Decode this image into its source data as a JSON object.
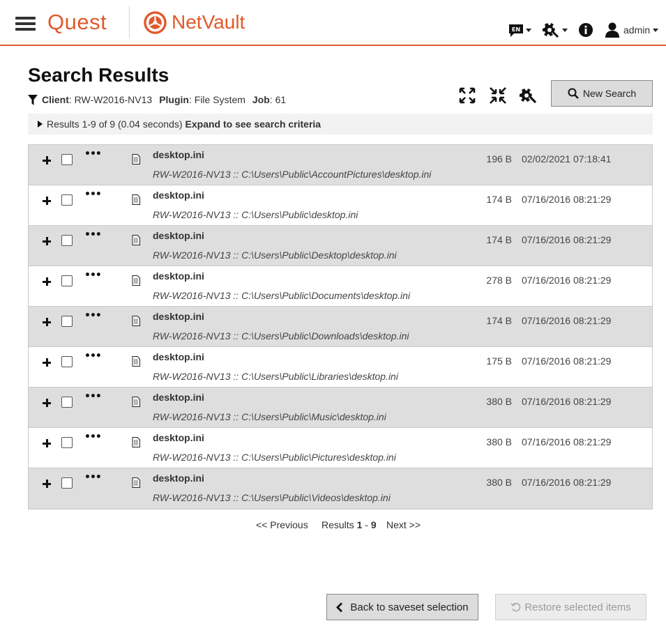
{
  "header": {
    "brand": "Quest",
    "product": "NetVault",
    "language_badge": "EN",
    "user": "admin",
    "accent_color": "#e05a2b"
  },
  "page": {
    "title": "Search Results",
    "filter": {
      "client_label": "Client",
      "client_value": "RW-W2016-NV13",
      "plugin_label": "Plugin",
      "plugin_value": "File System",
      "job_label": "Job",
      "job_value": "61"
    },
    "new_search_label": "New Search",
    "summary_text": "Results 1-9 of 9 (0.04 seconds)",
    "summary_link": "Expand to see search criteria"
  },
  "results": [
    {
      "name": "desktop.ini",
      "path": "RW-W2016-NV13 :: C:\\Users\\Public\\AccountPictures\\desktop.ini",
      "size": "196 B",
      "date": "02/02/2021 07:18:41"
    },
    {
      "name": "desktop.ini",
      "path": "RW-W2016-NV13 :: C:\\Users\\Public\\desktop.ini",
      "size": "174 B",
      "date": "07/16/2016 08:21:29"
    },
    {
      "name": "desktop.ini",
      "path": "RW-W2016-NV13 :: C:\\Users\\Public\\Desktop\\desktop.ini",
      "size": "174 B",
      "date": "07/16/2016 08:21:29"
    },
    {
      "name": "desktop.ini",
      "path": "RW-W2016-NV13 :: C:\\Users\\Public\\Documents\\desktop.ini",
      "size": "278 B",
      "date": "07/16/2016 08:21:29"
    },
    {
      "name": "desktop.ini",
      "path": "RW-W2016-NV13 :: C:\\Users\\Public\\Downloads\\desktop.ini",
      "size": "174 B",
      "date": "07/16/2016 08:21:29"
    },
    {
      "name": "desktop.ini",
      "path": "RW-W2016-NV13 :: C:\\Users\\Public\\Libraries\\desktop.ini",
      "size": "175 B",
      "date": "07/16/2016 08:21:29"
    },
    {
      "name": "desktop.ini",
      "path": "RW-W2016-NV13 :: C:\\Users\\Public\\Music\\desktop.ini",
      "size": "380 B",
      "date": "07/16/2016 08:21:29"
    },
    {
      "name": "desktop.ini",
      "path": "RW-W2016-NV13 :: C:\\Users\\Public\\Pictures\\desktop.ini",
      "size": "380 B",
      "date": "07/16/2016 08:21:29"
    },
    {
      "name": "desktop.ini",
      "path": "RW-W2016-NV13 :: C:\\Users\\Public\\Videos\\desktop.ini",
      "size": "380 B",
      "date": "07/16/2016 08:21:29"
    }
  ],
  "pagination": {
    "previous_label": "<< Previous",
    "results_label": "Results",
    "range_start": "1",
    "range_sep": " - ",
    "range_end": "9",
    "next_label": "Next >>"
  },
  "footer": {
    "back_label": "Back to saveset selection",
    "restore_label": "Restore selected items"
  },
  "icons": {
    "menu": "hamburger-icon",
    "language": "language-icon",
    "settings": "tools-icon",
    "info": "info-icon",
    "user": "user-icon",
    "expand": "expand-icon",
    "collapse": "collapse-icon",
    "table_settings": "gear-icon",
    "search": "search-icon",
    "file": "file-icon",
    "back": "chevron-left-icon",
    "restore": "restore-icon"
  }
}
